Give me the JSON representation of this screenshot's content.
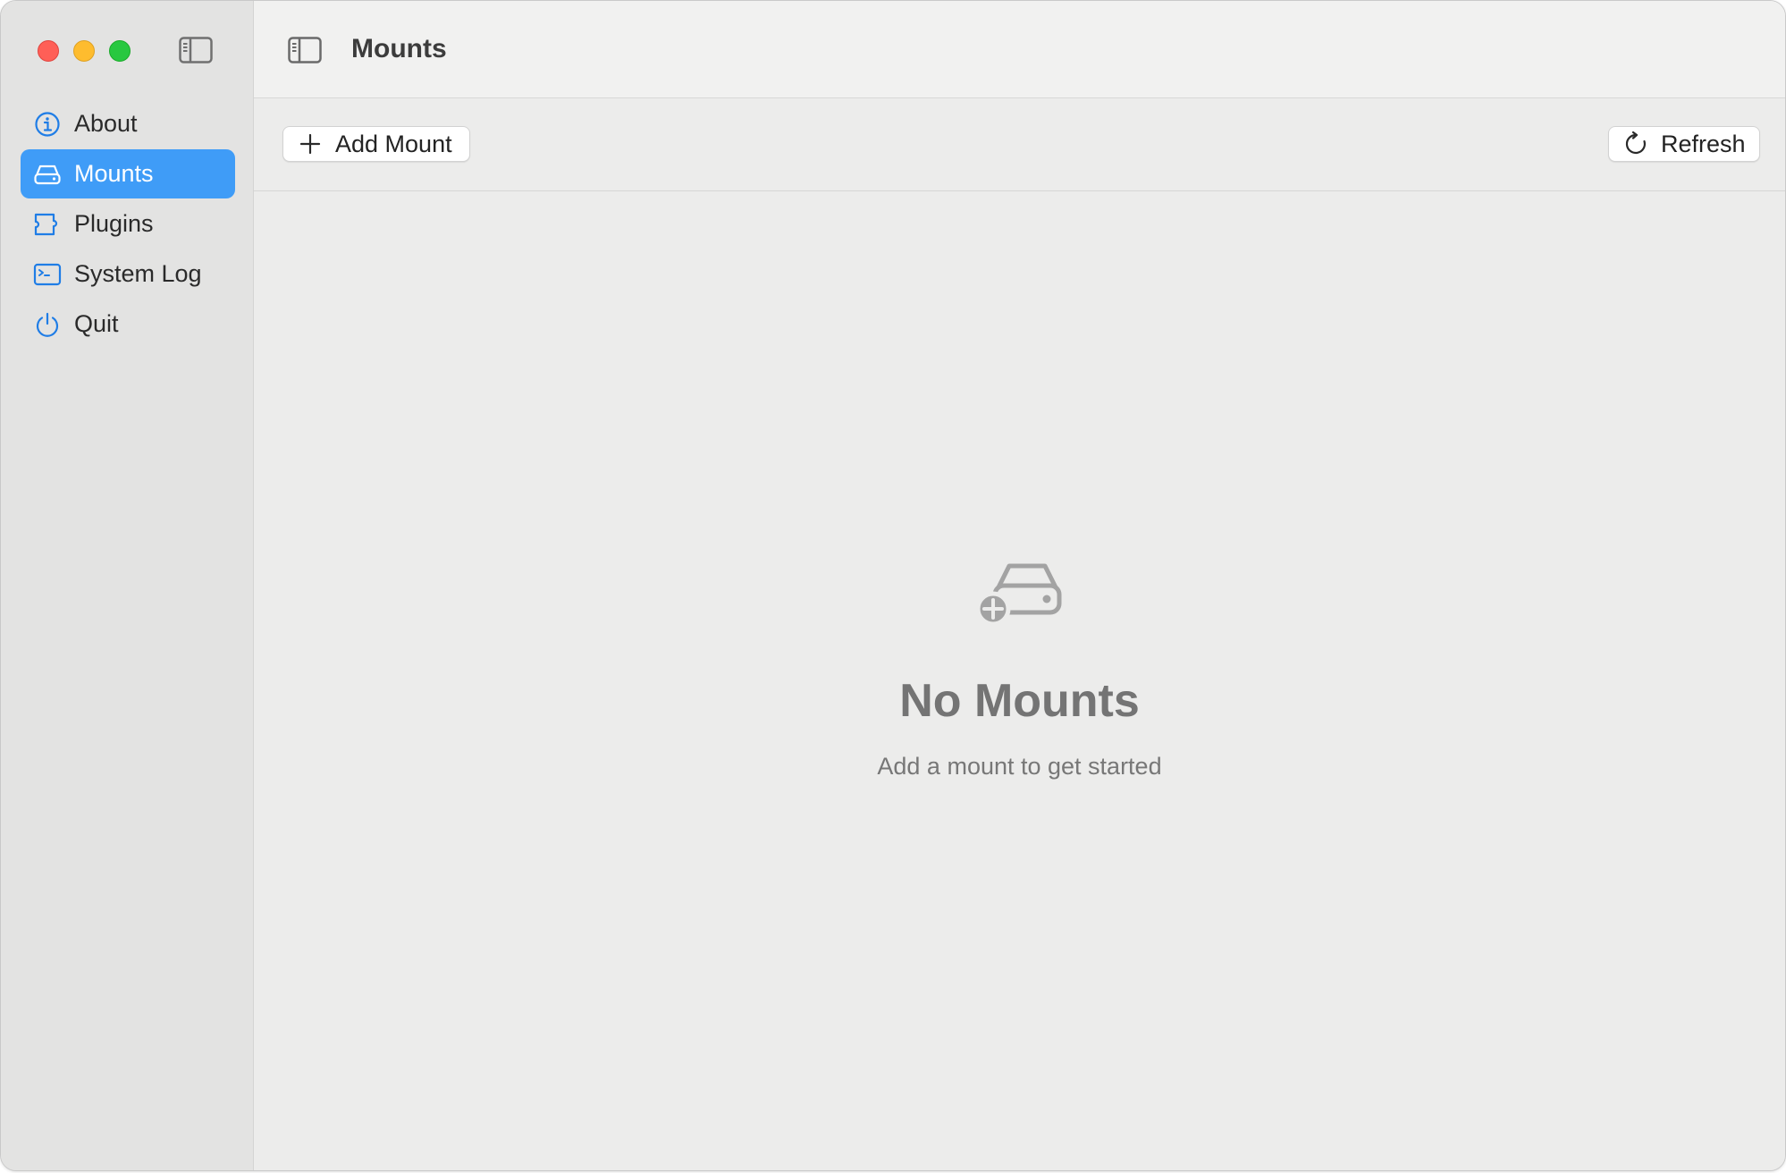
{
  "window": {
    "title": "Mounts"
  },
  "sidebar": {
    "items": [
      {
        "label": "About",
        "icon": "info-circle-icon",
        "active": false
      },
      {
        "label": "Mounts",
        "icon": "drive-icon",
        "active": true
      },
      {
        "label": "Plugins",
        "icon": "puzzle-icon",
        "active": false
      },
      {
        "label": "System Log",
        "icon": "terminal-icon",
        "active": false
      },
      {
        "label": "Quit",
        "icon": "power-icon",
        "active": false
      }
    ]
  },
  "toolbar": {
    "add_label": "Add Mount",
    "refresh_label": "Refresh"
  },
  "empty_state": {
    "icon": "drive-add-icon",
    "title": "No Mounts",
    "subtitle": "Add a mount to get started"
  },
  "colors": {
    "accent": "#3f9cf7",
    "close": "#ff5f57",
    "minimize": "#febc2e",
    "zoom": "#28c840"
  }
}
